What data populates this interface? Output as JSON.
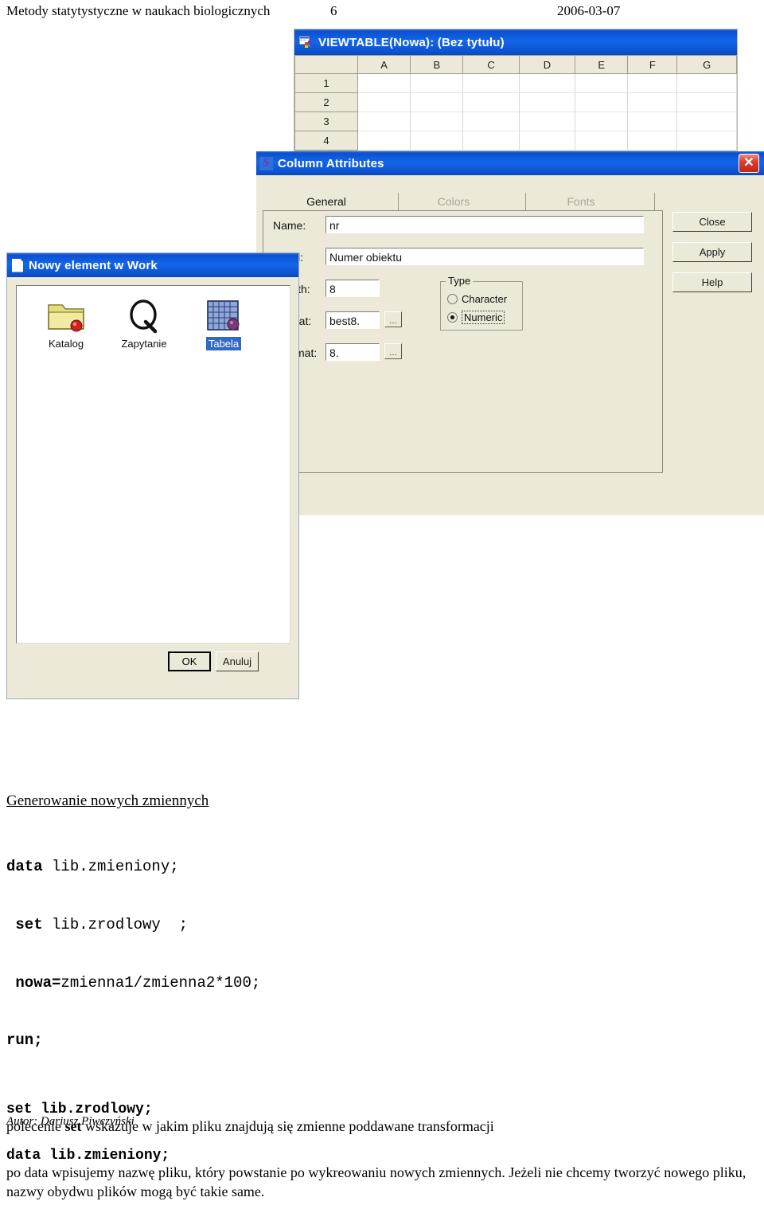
{
  "page_header": {
    "title": "Metody statytystyczne w naukach biologicznych",
    "page_number": "6",
    "date": "2006-03-07"
  },
  "viewtable": {
    "title": "VIEWTABLE(Nowa): (Bez tytułu)",
    "icon": "table-window-icon",
    "columns": [
      "A",
      "B",
      "C",
      "D",
      "E",
      "F",
      "G"
    ],
    "rows": [
      "1",
      "2",
      "3",
      "4"
    ]
  },
  "column_attributes": {
    "title": "Column Attributes",
    "icon": "sas-logo-icon",
    "close_glyph": "✕",
    "tabs": [
      {
        "label": "General",
        "active": true
      },
      {
        "label": "Colors",
        "active": false
      },
      {
        "label": "Fonts",
        "active": false
      }
    ],
    "fields": {
      "name_label": "Name:",
      "name_value": "nr",
      "label_label": "Label:",
      "label_value": "Numer obiektu",
      "length_label": "Length:",
      "length_value": "8",
      "format_label": "Format:",
      "format_value": "best8.",
      "informat_label": "Informat:",
      "informat_value": "8.",
      "ellipsis_label": "..."
    },
    "type_group": {
      "title": "Type",
      "options": [
        {
          "label": "Character",
          "selected": false
        },
        {
          "label": "Numeric",
          "selected": true
        }
      ]
    },
    "buttons": [
      {
        "label": "Close"
      },
      {
        "label": "Apply"
      },
      {
        "label": "Help"
      }
    ]
  },
  "new_item_dialog": {
    "title": "Nowy element w Work",
    "icon": "new-document-icon",
    "items": [
      {
        "label": "Katalog",
        "icon": "folder-icon",
        "selected": false
      },
      {
        "label": "Zapytanie",
        "icon": "query-q-icon",
        "selected": false
      },
      {
        "label": "Tabela",
        "icon": "table-grid-icon",
        "selected": true
      }
    ],
    "ok_label": "OK",
    "cancel_label": "Anuluj"
  },
  "lecture": {
    "heading": "Generowanie nowych zmiennych",
    "code_lines": [
      {
        "bold": "data ",
        "rest": "lib.zmieniony;"
      },
      {
        "bold": " set ",
        "rest": "lib.zrodlowy  ;"
      },
      {
        "bold": " nowa=",
        "rest": "zmienna1/zmienna2*100;"
      },
      {
        "bold": "run;",
        "rest": ""
      }
    ],
    "blocks": [
      {
        "mono": "set lib.zrodlowy;",
        "text_before": "polecenie ",
        "text_bold": "set",
        "text_after": " wskazuje w jakim pliku znajdują się zmienne poddawane transformacji"
      },
      {
        "mono": "data lib.zmieniony;",
        "text_before": "po data wpisujemy nazwę pliku, który powstanie po wykreowaniu nowych zmiennych. Jeżeli nie chcemy tworzyć nowego pliku, nazwy obydwu plików mogą być takie same.",
        "text_bold": "",
        "text_after": ""
      }
    ]
  },
  "footer": {
    "author": "Autor: Dariusz Piwczyński"
  }
}
